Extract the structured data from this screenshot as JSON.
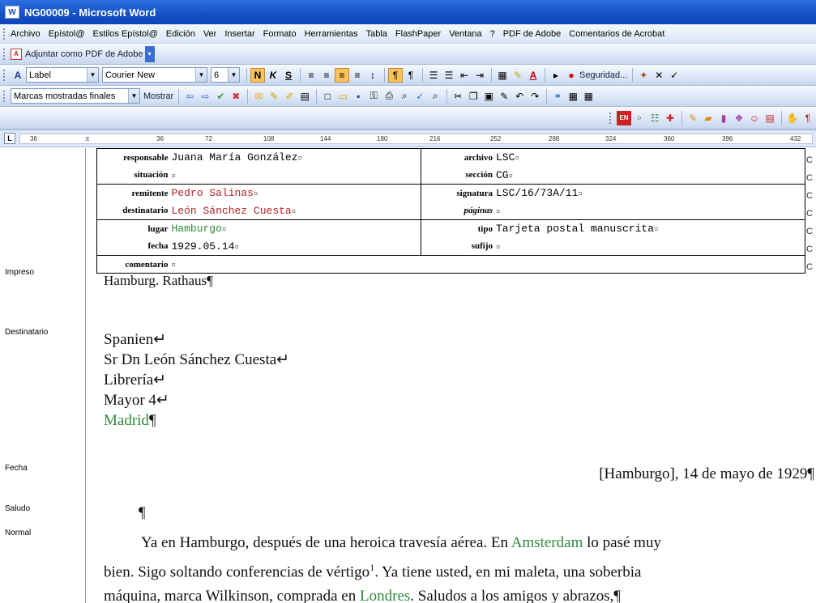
{
  "window": {
    "title": "NG00009 - Microsoft Word",
    "app_icon": "word-icon"
  },
  "menu": [
    "Archivo",
    "Epístol@",
    "Estilos Epístol@",
    "Edición",
    "Ver",
    "Insertar",
    "Formato",
    "Herramientas",
    "Tabla",
    "FlashPaper",
    "Ventana",
    "?",
    "PDF de Adobe",
    "Comentarios de Acrobat"
  ],
  "pdf_toolbar": {
    "label": "Adjuntar como PDF de Adobe"
  },
  "format_toolbar": {
    "style": "Label",
    "font": "Courier New",
    "size": "6",
    "bold": "N",
    "italic": "K",
    "underline": "S",
    "security": "Seguridad..."
  },
  "review_toolbar": {
    "display": "Marcas mostradas finales",
    "show": "Mostrar"
  },
  "ruler": {
    "ticks": [
      "36",
      "36",
      "72",
      "108",
      "144",
      "180",
      "216",
      "252",
      "288",
      "324",
      "360",
      "396",
      "432"
    ]
  },
  "style_area": [
    "Impreso",
    "Destinatario",
    "Fecha",
    "Saludo",
    "Normal"
  ],
  "meta_table": {
    "rows": [
      {
        "lk": "responsable",
        "lv": "Juana María González",
        "rk": "archivo",
        "rv": "LSC"
      },
      {
        "lk": "situación",
        "lv": "",
        "rk": "sección",
        "rv": "CG"
      },
      {
        "lk": "remitente",
        "lv": "Pedro Salinas",
        "rk": "signatura",
        "rv": "LSC/16/73A/11"
      },
      {
        "lk": "destinatario",
        "lv": "León Sánchez Cuesta",
        "rk": "páginas",
        "rv": ""
      },
      {
        "lk": "lugar",
        "lv": "Hamburgo",
        "rk": "tipo",
        "rv": "Tarjeta postal manuscrita"
      },
      {
        "lk": "fecha",
        "lv": "1929.05.14",
        "rk": "sufijo",
        "rv": ""
      },
      {
        "lk": "comentario",
        "lv": "",
        "rk": "",
        "rv": ""
      }
    ],
    "cell_mark": "¤",
    "edge_mark": "C"
  },
  "body": {
    "impreso": "Hamburg. Rathaus¶",
    "destinatario": [
      "Spanien↵",
      "Sr Dn León Sánchez Cuesta↵",
      "Librería↵",
      "Mayor 4↵"
    ],
    "dest_city": "Madrid",
    "pilcrow": "¶",
    "fecha": "[Hamburgo], 14 de mayo de 1929¶",
    "saludo": "¶",
    "p1a": "Ya en Hamburgo, después de una heroica travesía aérea. En ",
    "p1_place1": "Amsterdam",
    "p1b": " lo pasé muy",
    "p2a": "bien. Sigo soltando conferencias de vértigo",
    "p2_note": "1",
    "p2b": ". Ya tiene usted, en mi maleta, una soberbia",
    "p3a": "máquina, marca Wilkinson, comprada en ",
    "p3_place": "Londres",
    "p3b": ". Saludos a los amigos y abrazos,¶"
  }
}
